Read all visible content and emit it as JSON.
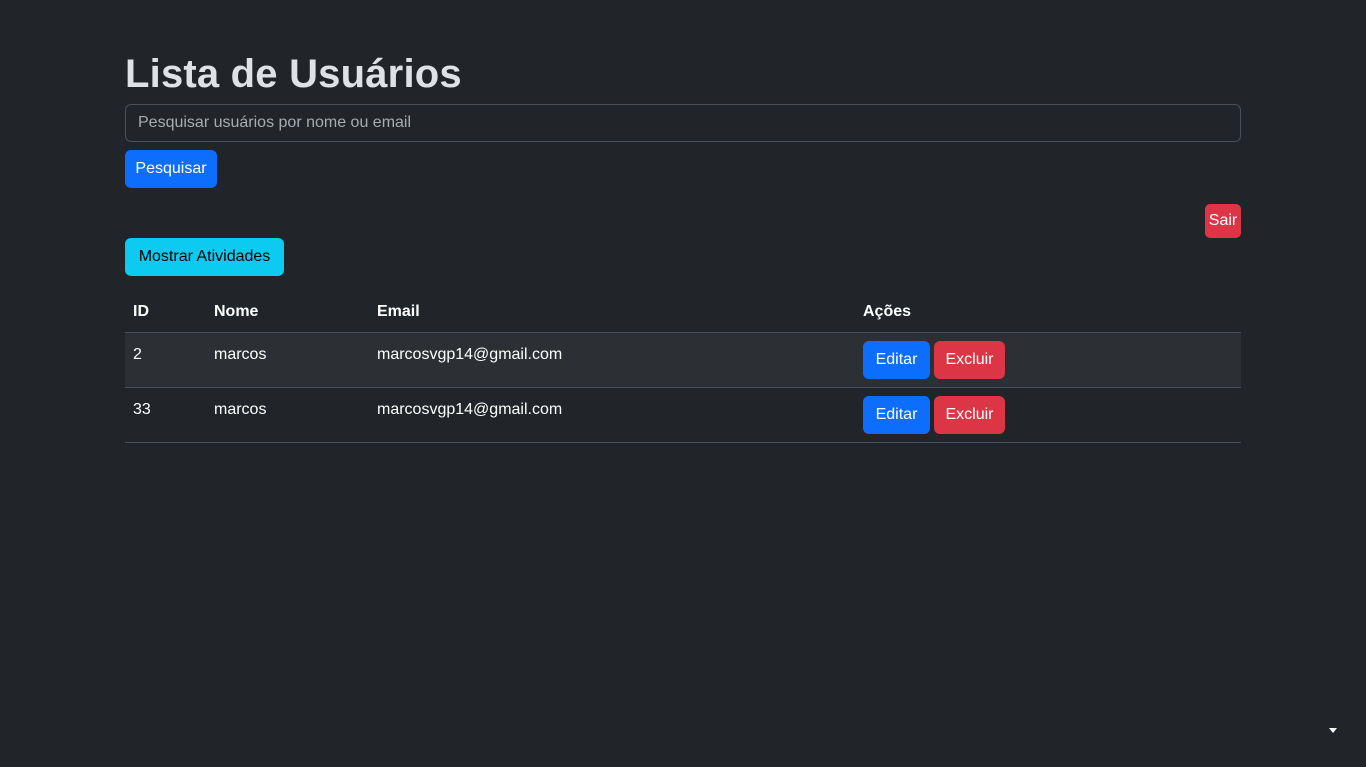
{
  "page": {
    "title": "Lista de Usuários"
  },
  "search": {
    "placeholder": "Pesquisar usuários por nome ou email",
    "button_label": "Pesquisar"
  },
  "logout_label": "Sair",
  "activities_label": "Mostrar Atividades",
  "table": {
    "headers": [
      "ID",
      "Nome",
      "Email",
      "Ações"
    ],
    "rows": [
      {
        "id": "2",
        "name": "marcos",
        "email": "marcosvgp14@gmail.com",
        "edit_label": "Editar",
        "delete_label": "Excluir"
      },
      {
        "id": "33",
        "name": "marcos",
        "email": "marcosvgp14@gmail.com",
        "edit_label": "Editar",
        "delete_label": "Excluir"
      }
    ]
  },
  "colors": {
    "background": "#212529",
    "primary": "#0d6efd",
    "danger": "#dc3545",
    "info": "#0dcaf0"
  },
  "icons": {
    "corner": "caret-down-icon"
  }
}
